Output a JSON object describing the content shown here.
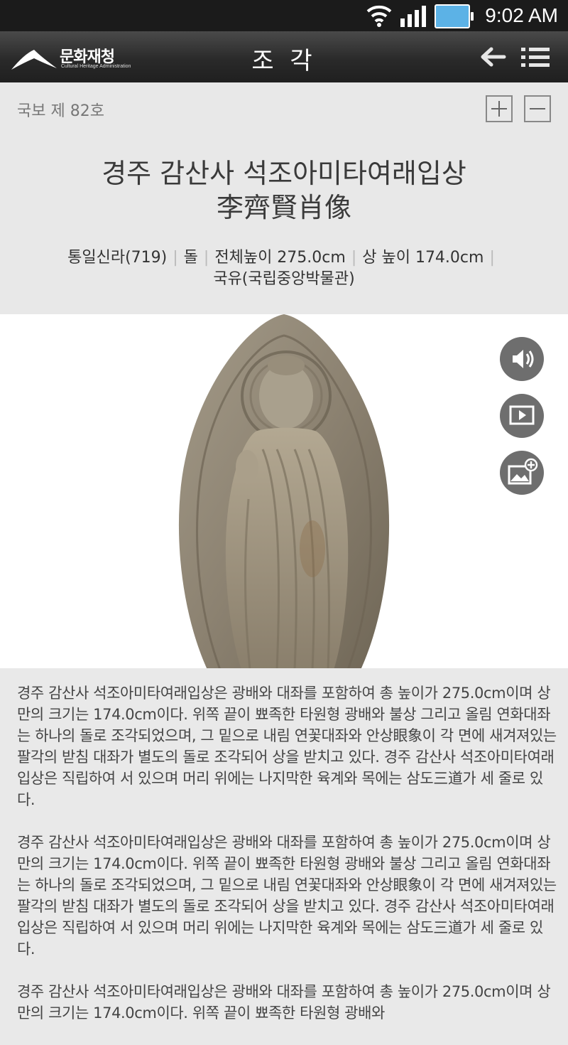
{
  "status_bar": {
    "time": "9:02 AM"
  },
  "header": {
    "logo_korean": "문화재청",
    "logo_english": "Cultural Heritage Administration",
    "title": "조 각"
  },
  "info": {
    "designation": "국보 제 82호",
    "title_korean": "경주 감산사 석조아미타여래입상",
    "title_hanja": "李齊賢肖像",
    "meta": [
      "통일신라(719)",
      "돌",
      "전체높이 275.0cm",
      "상 높이 174.0cm",
      "국유(국립중앙박물관)"
    ]
  },
  "description": [
    "경주 감산사 석조아미타여래입상은 광배와 대좌를 포함하여 총 높이가 275.0cm이며 상만의 크기는 174.0cm이다. 위쪽 끝이 뾰족한 타원형 광배와 불상 그리고 올림 연화대좌는 하나의 돌로 조각되었으며, 그 밑으로 내림 연꽃대좌와 안상眼象이 각 면에 새겨져있는 팔각의 받침 대좌가 별도의 돌로 조각되어 상을 받치고 있다. 경주 감산사 석조아미타여래입상은 직립하여 서 있으며 머리 위에는 나지막한 육계와 목에는 삼도三道가 세 줄로 있다.",
    "경주 감산사 석조아미타여래입상은 광배와 대좌를 포함하여 총 높이가 275.0cm이며 상만의 크기는 174.0cm이다. 위쪽 끝이 뾰족한 타원형 광배와 불상 그리고 올림 연화대좌는 하나의 돌로 조각되었으며, 그 밑으로 내림 연꽃대좌와 안상眼象이 각 면에 새겨져있는 팔각의 받침 대좌가 별도의 돌로 조각되어 상을 받치고 있다. 경주 감산사 석조아미타여래입상은 직립하여 서 있으며 머리 위에는 나지막한 육계와 목에는 삼도三道가 세 줄로 있다.",
    "경주 감산사 석조아미타여래입상은 광배와 대좌를 포함하여 총 높이가 275.0cm이며 상만의 크기는 174.0cm이다. 위쪽 끝이 뾰족한 타원형 광배와"
  ],
  "icons": {
    "audio": "speaker-icon",
    "video": "play-icon",
    "gallery": "image-plus-icon",
    "back": "back-arrow-icon",
    "menu": "list-menu-icon"
  },
  "colors": {
    "header_bg": "#2b2b2b",
    "info_bg": "#e8e8e8",
    "fab_bg": "#6e6e6e",
    "battery": "#5cb2e6"
  }
}
